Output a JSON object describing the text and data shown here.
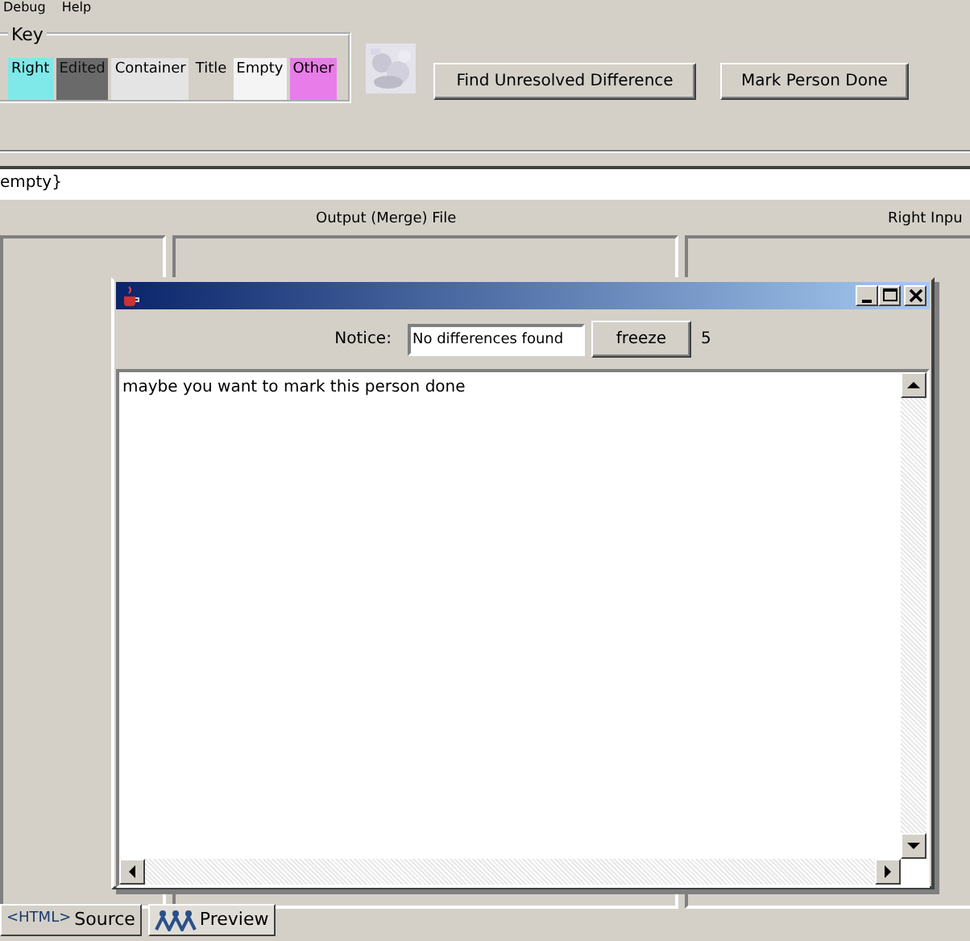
{
  "menu": [
    "Debug",
    "Help"
  ],
  "key": {
    "title": "Key",
    "items": [
      {
        "label": "Right",
        "color": "#7fe8e8"
      },
      {
        "label": "Edited",
        "color": "#6a6a6a"
      },
      {
        "label": "Container",
        "color": "#e4e4e4"
      },
      {
        "label": "Title",
        "color": "#d4d0c8"
      },
      {
        "label": "Empty",
        "color": "#f4f4f4"
      },
      {
        "label": "Other",
        "color": "#e87ce8"
      }
    ]
  },
  "buttons": [
    "Find Unresolved Difference",
    "Mark Person Done"
  ],
  "path_field": {
    "value": "empty}"
  },
  "columns": [
    "Output (Merge) File",
    "Right Inpu"
  ],
  "dialog": {
    "notice_label": "Notice:",
    "notice_value": "No differences found",
    "freeze": "freeze",
    "count": "5",
    "message": "maybe you want to mark this person done"
  },
  "tabs": [
    {
      "icon_text": "<HTML>",
      "label": "Source",
      "selected": false
    },
    {
      "label": "Preview",
      "selected": true
    }
  ]
}
